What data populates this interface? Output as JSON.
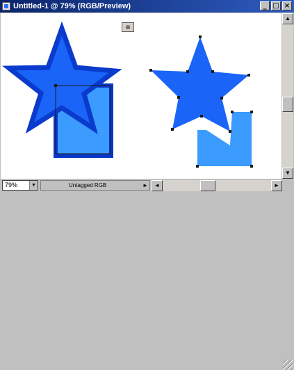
{
  "window": {
    "title": "Untitled-1 @ 79% (RGB/Preview)",
    "app_icon": "photoshop-doc-icon",
    "buttons": [
      {
        "name": "minimize-button",
        "glyph": "_"
      },
      {
        "name": "maximize-button",
        "glyph": "□"
      },
      {
        "name": "close-button",
        "glyph": "×"
      }
    ]
  },
  "canvas": {
    "floating_icon": "anchor-toggle-icon",
    "floating_icon_glyph": "⊕",
    "colors": {
      "star_fill": "#1a64f8",
      "star_stroke": "#0a3bcc",
      "rect_fill": "#3b9bff",
      "rect_stroke": "#0b37c7",
      "star_plain_fill": "#1a64f8",
      "rect_plain_fill": "#3b9bff",
      "anchor": "#1a1a1a"
    }
  },
  "status": {
    "zoom": "79%",
    "profile": "Untagged RGB"
  },
  "scroll": {
    "up_glyph": "▲",
    "down_glyph": "▼",
    "left_glyph": "◄",
    "right_glyph": "►",
    "dropdown_glyph": "▼"
  }
}
